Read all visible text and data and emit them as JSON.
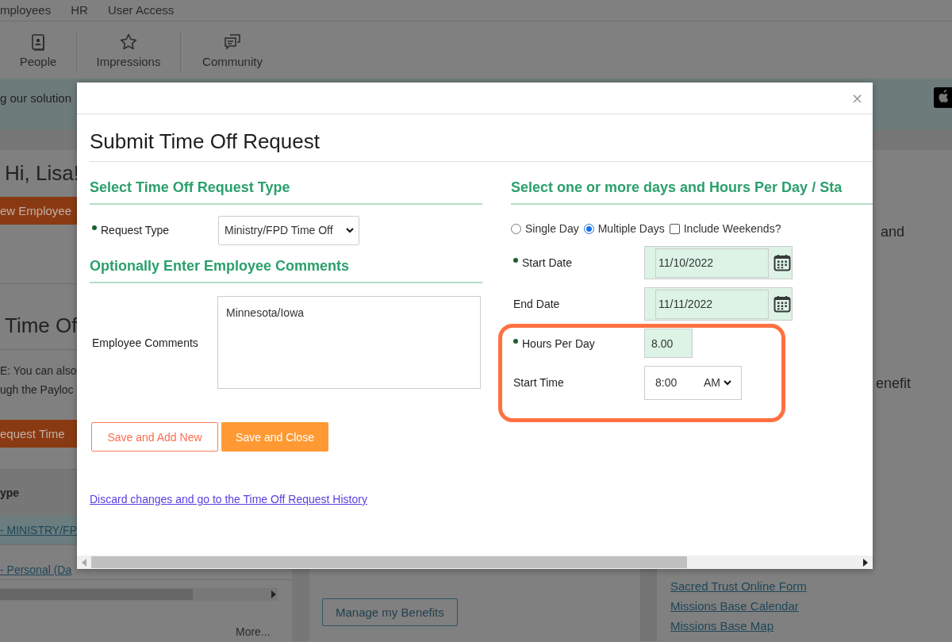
{
  "top_nav": {
    "items": [
      "mployees",
      "HR",
      "User Access"
    ]
  },
  "toolbar": {
    "items": [
      {
        "label": "People",
        "kind": "person-card"
      },
      {
        "label": "Impressions",
        "kind": "star"
      },
      {
        "label": "Community",
        "kind": "chat"
      }
    ]
  },
  "banner": {
    "text": "g our solution"
  },
  "left_panel": {
    "greeting": "Hi, Lisa!",
    "new_button": "ew Employee",
    "section_title": "Time Of",
    "note_lines": [
      "E: You can also",
      "ugh the Payloc"
    ],
    "request_button": "equest Time",
    "table": {
      "header": "ype",
      "rows": [
        {
          "text": "- MINISTRY/FP",
          "selected": true
        },
        {
          "text": "- Personal (Da",
          "selected": false
        }
      ]
    },
    "more_link": "More..."
  },
  "middle_panel": {
    "button": "Manage my Benefits"
  },
  "right_panel": {
    "texts": [
      "and",
      "enefit"
    ],
    "links": [
      "Sacred Trust Online Form",
      "Missions Base Calendar",
      "Missions Base Map"
    ]
  },
  "modal": {
    "close": "×",
    "title": "Submit Time Off Request",
    "left": {
      "type_heading": "Select Time Off Request Type",
      "request_type": {
        "label": "Request Type",
        "required": true,
        "value": "Ministry/FPD Time Off"
      },
      "comments_heading": "Optionally Enter Employee Comments",
      "comments": {
        "label": "Employee Comments",
        "value": "Minnesota/Iowa"
      },
      "buttons": [
        {
          "label": "Save and Add New",
          "kind": "outline"
        },
        {
          "label": "Save and Close",
          "kind": "primary"
        }
      ],
      "link": "Discard changes and go to the Time Off Request History"
    },
    "right": {
      "heading": "Select one or more days and Hours Per Day / Sta",
      "options": [
        {
          "label": "Single Day",
          "kind": "radio",
          "selected": false
        },
        {
          "label": "Multiple Days",
          "kind": "radio",
          "selected": true
        },
        {
          "label": "Include Weekends?",
          "kind": "checkbox",
          "checked": false
        }
      ],
      "fields": [
        {
          "label": "Start Date",
          "required": true,
          "kind": "date",
          "value": "11/10/2022"
        },
        {
          "label": "End Date",
          "required": false,
          "kind": "date",
          "value": "11/11/2022"
        },
        {
          "label": "Hours Per Day",
          "required": true,
          "kind": "number",
          "value": "8.00"
        },
        {
          "label": "Start Time",
          "required": false,
          "kind": "time",
          "value": "8:00",
          "period": "AM"
        }
      ]
    }
  },
  "highlight": {
    "kind": "outline"
  }
}
